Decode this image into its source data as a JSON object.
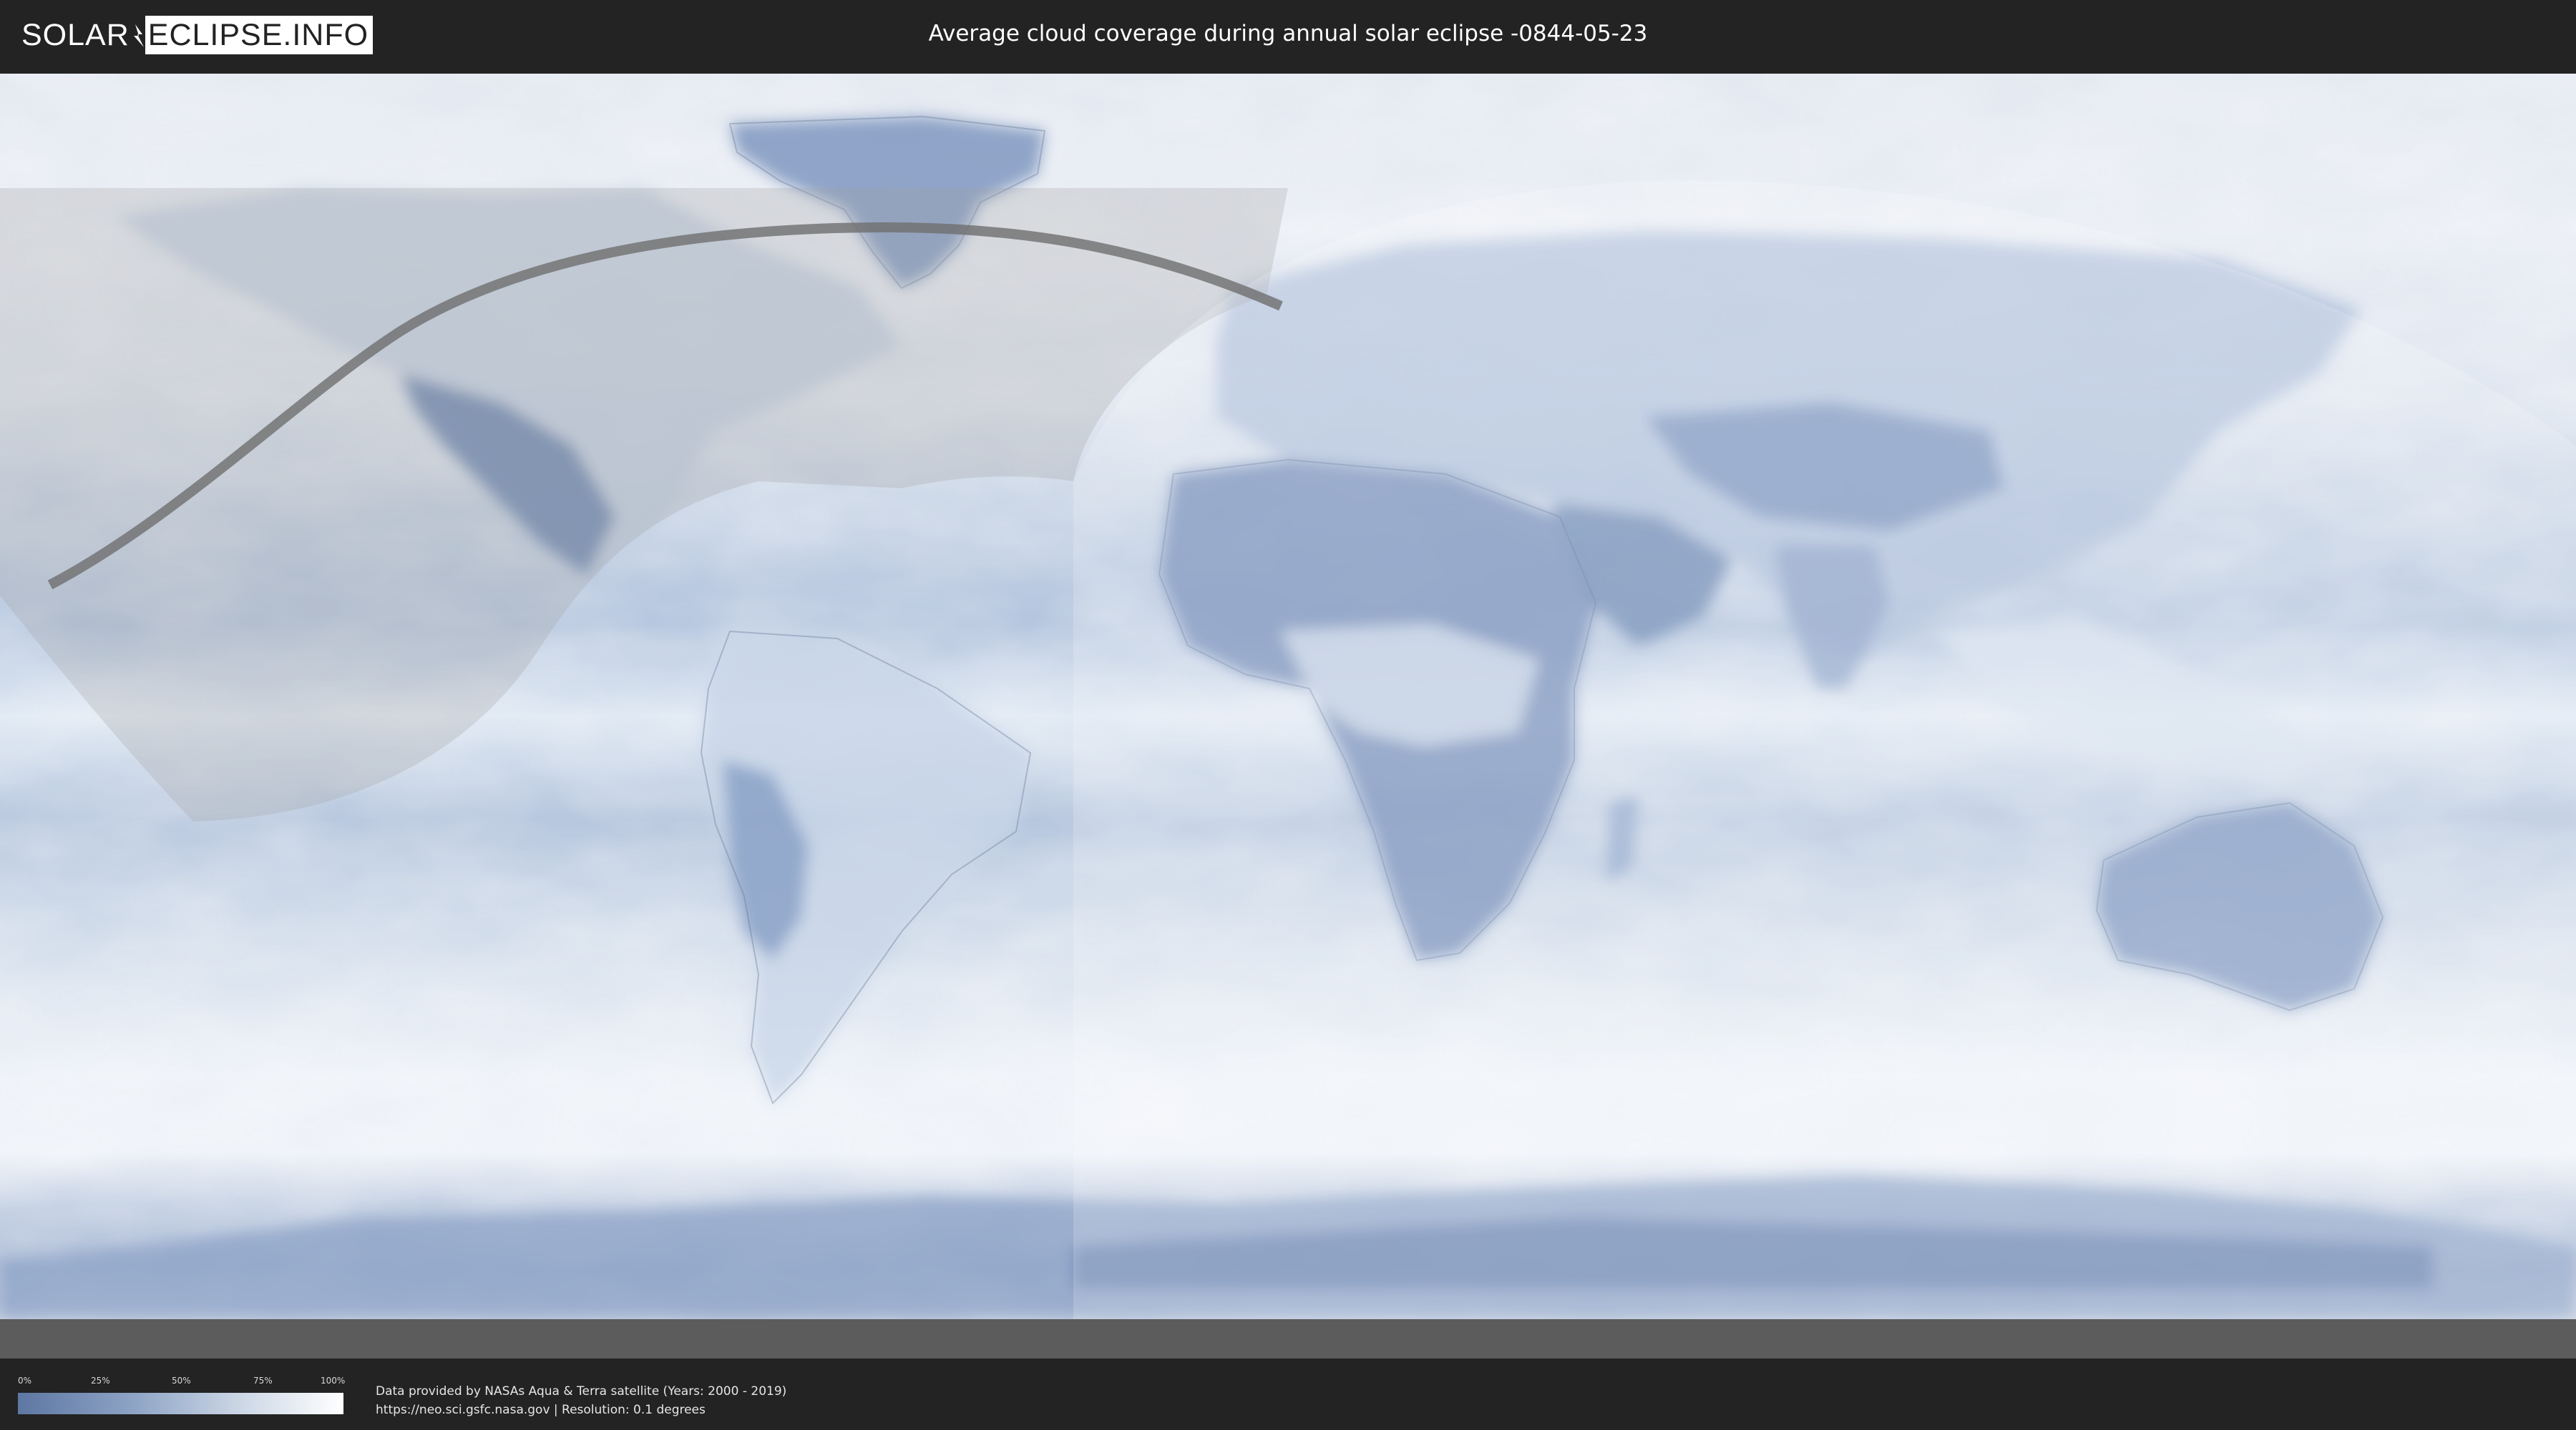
{
  "header": {
    "logo_left": "SOLAR",
    "logo_right": "ECLIPSE.INFO",
    "title": "Average cloud coverage during annual solar eclipse -0844-05-23"
  },
  "legend": {
    "ticks": [
      "0%",
      "25%",
      "50%",
      "75%",
      "100%"
    ],
    "min_color": "#5d77a3",
    "max_color": "#ffffff"
  },
  "footer": {
    "credit_line1": "Data provided by NASAs Aqua & Terra satellite (Years: 2000 - 2019)",
    "credit_line2": "https://neo.sci.gsfc.nasa.gov | Resolution: 0.1 degrees"
  },
  "colors": {
    "cloud_white": "#eef2f8",
    "clear_sky": "#6f8ab4",
    "eclipse_path": "#6e6e6e",
    "shade_overlay": "#9a9a9a"
  }
}
